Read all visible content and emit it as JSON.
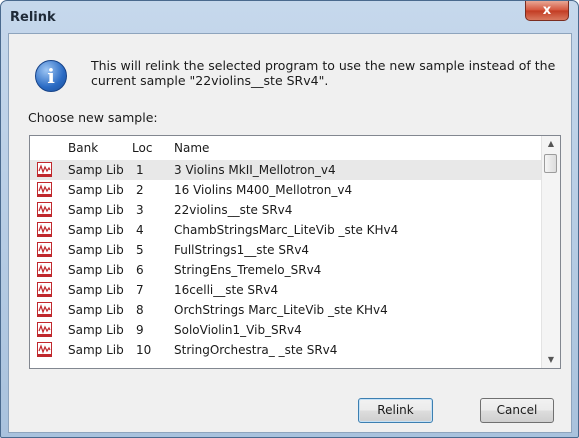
{
  "window": {
    "title": "Relink",
    "close_glyph": "x"
  },
  "message": "This will relink the selected program to use the new sample instead of the current sample \"22violins__ste SRv4\".",
  "info_icon": {
    "name": "info-icon",
    "glyph": "i"
  },
  "choose_label": "Choose new sample:",
  "list": {
    "columns": {
      "bank": "Bank",
      "loc": "Loc",
      "name": "Name"
    },
    "rows": [
      {
        "bank": "Samp Lib",
        "loc": "1",
        "name": "3 Violins MkII_Mellotron_v4",
        "selected": true
      },
      {
        "bank": "Samp Lib",
        "loc": "2",
        "name": "16 Violins M400_Mellotron_v4"
      },
      {
        "bank": "Samp Lib",
        "loc": "3",
        "name": "22violins__ste SRv4"
      },
      {
        "bank": "Samp Lib",
        "loc": "4",
        "name": "ChambStringsMarc_LiteVib _ste KHv4"
      },
      {
        "bank": "Samp Lib",
        "loc": "5",
        "name": "FullStrings1__ste SRv4"
      },
      {
        "bank": "Samp Lib",
        "loc": "6",
        "name": "StringEns_Tremelo_SRv4"
      },
      {
        "bank": "Samp Lib",
        "loc": "7",
        "name": "16celli__ste SRv4"
      },
      {
        "bank": "Samp Lib",
        "loc": "8",
        "name": "OrchStrings Marc_LiteVib _ste KHv4"
      },
      {
        "bank": "Samp Lib",
        "loc": "9",
        "name": "SoloViolin1_Vib_SRv4"
      },
      {
        "bank": "Samp Lib",
        "loc": "10",
        "name": "StringOrchestra_ _ste SRv4"
      }
    ]
  },
  "buttons": {
    "relink": "Relink",
    "cancel": "Cancel"
  },
  "colors": {
    "accent": "#3c7fb1",
    "sample_icon": "#c0282d",
    "selected_row": "#e8e8e8"
  }
}
